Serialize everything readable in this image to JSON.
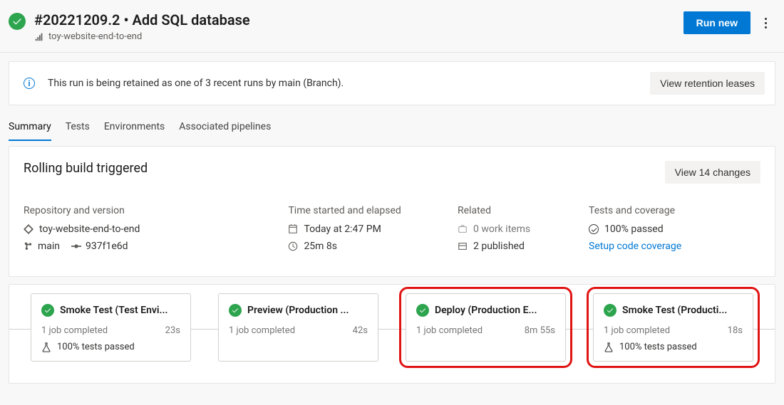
{
  "header": {
    "title": "#20221209.2 • Add SQL database",
    "pipeline_name": "toy-website-end-to-end",
    "run_new_label": "Run new"
  },
  "banner": {
    "message": "This run is being retained as one of 3 recent runs by main (Branch).",
    "action_label": "View retention leases"
  },
  "tabs": [
    {
      "label": "Summary",
      "active": true
    },
    {
      "label": "Tests"
    },
    {
      "label": "Environments"
    },
    {
      "label": "Associated pipelines"
    }
  ],
  "summary": {
    "heading": "Rolling build triggered",
    "changes_button": "View 14 changes",
    "repo": {
      "label": "Repository and version",
      "repo_name": "toy-website-end-to-end",
      "branch": "main",
      "commit": "937f1e6d"
    },
    "time": {
      "label": "Time started and elapsed",
      "started": "Today at 2:47 PM",
      "elapsed": "25m 8s"
    },
    "related": {
      "label": "Related",
      "work_items": "0 work items",
      "published": "2 published"
    },
    "tests": {
      "label": "Tests and coverage",
      "passed": "100% passed",
      "setup_link": "Setup code coverage"
    }
  },
  "stages": [
    {
      "title": "Smoke Test (Test Envi...",
      "jobs": "1 job completed",
      "duration": "23s",
      "tests": "100% tests passed",
      "highlight": false
    },
    {
      "title": "Preview (Production ...",
      "jobs": "1 job completed",
      "duration": "42s",
      "tests": null,
      "highlight": false
    },
    {
      "title": "Deploy (Production E...",
      "jobs": "1 job completed",
      "duration": "8m 55s",
      "tests": null,
      "highlight": true
    },
    {
      "title": "Smoke Test (Producti...",
      "jobs": "1 job completed",
      "duration": "18s",
      "tests": "100% tests passed",
      "highlight": true
    }
  ]
}
